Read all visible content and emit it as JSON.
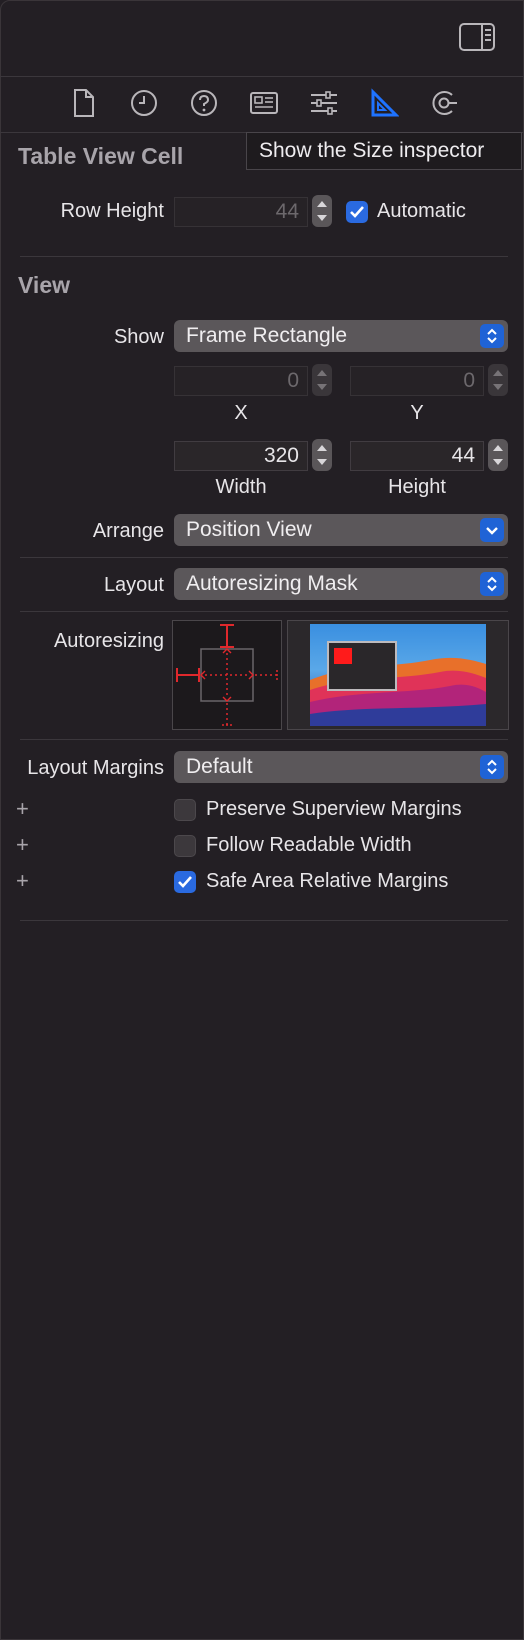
{
  "toolbar": {
    "tabs": [
      {
        "name": "file-inspector",
        "icon": "document-icon"
      },
      {
        "name": "history-inspector",
        "icon": "clock-icon"
      },
      {
        "name": "quick-help-inspector",
        "icon": "question-icon"
      },
      {
        "name": "identity-inspector",
        "icon": "id-card-icon"
      },
      {
        "name": "attributes-inspector",
        "icon": "sliders-icon"
      },
      {
        "name": "size-inspector",
        "icon": "ruler-triangle-icon",
        "selected": true
      },
      {
        "name": "connections-inspector",
        "icon": "arrow-circle-icon"
      }
    ],
    "tooltip": "Show the Size inspector"
  },
  "table_view_cell": {
    "title": "Table View Cell",
    "row_height_label": "Row Height",
    "row_height_value": "44",
    "automatic_label": "Automatic",
    "automatic_checked": true
  },
  "view": {
    "title": "View",
    "show_label": "Show",
    "show_value": "Frame Rectangle",
    "x_value": "0",
    "y_value": "0",
    "x_caption": "X",
    "y_caption": "Y",
    "width_value": "320",
    "height_value": "44",
    "width_caption": "Width",
    "height_caption": "Height",
    "arrange_label": "Arrange",
    "arrange_value": "Position View",
    "layout_label": "Layout",
    "layout_value": "Autoresizing Mask",
    "autoresizing_label": "Autoresizing",
    "layout_margins_label": "Layout Margins",
    "layout_margins_value": "Default",
    "options": [
      {
        "label": "Preserve Superview Margins",
        "checked": false
      },
      {
        "label": "Follow Readable Width",
        "checked": false
      },
      {
        "label": "Safe Area Relative Margins",
        "checked": true
      }
    ]
  },
  "colors": {
    "background": "#231f24",
    "accent": "#2a6ae0",
    "autoresizing_strut": "#e0282c"
  }
}
